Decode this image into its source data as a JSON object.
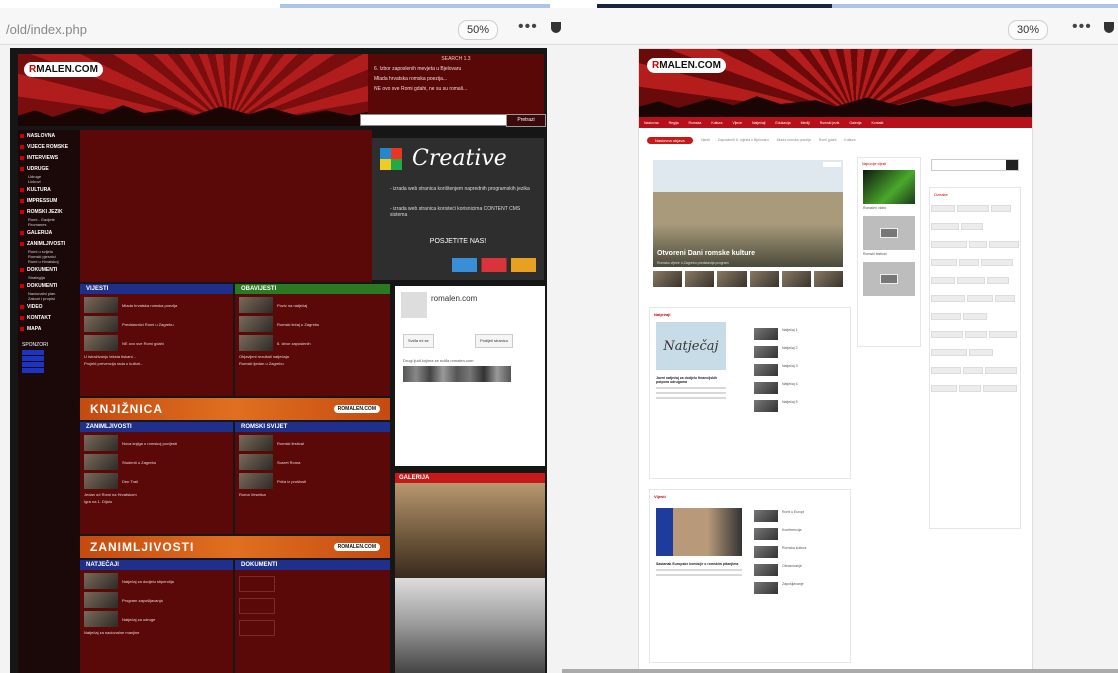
{
  "left": {
    "url": "/old/index.php",
    "zoom": "50%",
    "menu_dots": "•••",
    "site": {
      "logo_prefix": "R",
      "logo_rest": "MALEN.COM",
      "news_heading": "SEARCH 1.3",
      "news": [
        "6. Izbor zaposlenih mevjeta u Bjelovaru",
        "Mlada hrvatska romska poezija...",
        "NE ovo sve Romi gdahi, ne su su romali..."
      ],
      "search_button": "Pretrazi",
      "menu": [
        {
          "label": "NASLOVNA"
        },
        {
          "label": "VIJECE ROMSKE"
        },
        {
          "label": "INTERVIEWS"
        },
        {
          "label": "UDRUGE",
          "sub": [
            "Udruge",
            "Linkovi"
          ]
        },
        {
          "label": "KULTURA"
        },
        {
          "label": "IMPRESSUM"
        },
        {
          "label": "ROMSKI JEZIK",
          "sub": [
            "Romi - Gadjete",
            "Rromanes"
          ]
        },
        {
          "label": "GALERIJA"
        },
        {
          "label": "ZANIMLJIVOSTI",
          "sub": [
            "Romi u svijetu",
            "Romski pjesnici",
            "Romi u Hrvatskoj"
          ]
        },
        {
          "label": "DOKUMENTI",
          "sub": [
            "Strategija"
          ]
        },
        {
          "label": "DOKUMENTI",
          "sub": [
            "Nacionalni plan",
            "Zakoni i propisi"
          ]
        },
        {
          "label": "VIDEO"
        },
        {
          "label": "KONTAKT"
        },
        {
          "label": "MAPA"
        }
      ],
      "sponsors_label": "SPONZORI",
      "creative": {
        "title": "Creative",
        "bullets": [
          "- izrada web stranica korištenjem naprednih programskih jezika",
          "- izrada web stranica koristeći korisnicima CONTENT CMS sistema"
        ],
        "visit": "POSJETITE NAS!"
      },
      "sections": [
        {
          "title": "VIJESTI",
          "rows": [
            "Mlada hrvatska romska poezija",
            "Predstavnici Romi u Zagrebu",
            "NE ovo sve Romi gdahi"
          ],
          "footer": [
            "U Istraživanju teksta tiskani...",
            "Projekt prevencija rada u kulturi..."
          ]
        },
        {
          "title": "OBAVIJESTI",
          "rows": [
            "Poziv na natječaj",
            "Romski tečaj u Zagrebu",
            "6. Izbor zaposlenih"
          ],
          "footer": [
            "Objavljeni rezultati natječaja",
            "Romski tjedan u Zagrebu"
          ]
        },
        {
          "title": "ZANIMLJIVOSTI",
          "rows": [
            "Nova knjiga o romskoj povijesti",
            "Studenti u Zagrebu",
            "Den Trail"
          ],
          "footer": [
            "Jedan od Romi na Hrvatskom",
            "Igra na 1. Dijalu"
          ]
        },
        {
          "title": "ROMSKI SVIJET",
          "rows": [
            "Romski festival",
            "Susret Roma",
            "Priča iz prošlosti"
          ],
          "footer": [
            "Roma Veselica"
          ]
        },
        {
          "title": "NATJEČAJI",
          "rows": [
            "Natječaj za dodjelu stipendija",
            "Program zapošljavanja",
            "Natječaj za udruge"
          ],
          "footer": [
            "Natječaj za nacionalne manjine"
          ]
        },
        {
          "title": "DOKUMENTI",
          "rows": []
        }
      ],
      "bands": [
        "KNJIŽNICA",
        "ZANIMLJIVOSTI"
      ],
      "band_logo": "ROMALEN.COM",
      "fb": {
        "name": "romalen.com",
        "likes": "Sviđa mi se",
        "share": "Podijeli stranicu",
        "people": "Drugi ljudi kojima se sviđa romalen.com"
      },
      "gallery_title": "GALERIJA"
    }
  },
  "right": {
    "zoom": "30%",
    "menu_dots": "•••",
    "site": {
      "logo_prefix": "R",
      "logo_rest": "MALEN.COM",
      "nav": [
        "Naslovna",
        "Regija",
        "Romska",
        "Kultura",
        "Vijeće",
        "Natječaji",
        "Edukacija",
        "Mediji",
        "Romski jezik",
        "Galerija",
        "Kontakt"
      ],
      "tags_label": "Naslovna objava",
      "tags": [
        "Vijesti",
        "Zaposlenih 6. mjesta u Bjelovaru",
        "Mlada romska poezija",
        "Romi gdahi",
        "Kultura"
      ],
      "hero": {
        "caption": "Otvoreni Dani romske kulture",
        "sub": "Romsko vijeće u Zagrebu predstavlja program"
      },
      "sidebar_title": "Najnovije vijesti",
      "sidebar_items": [
        "Romalen video",
        "Romski festival"
      ],
      "search_placeholder": "",
      "tags_title": "Oznake",
      "natjecaj": {
        "section": "Natječaji",
        "image_text": "Natječaj",
        "caption": "Javni natječaj za dodjelu financijskih potpora udrugama",
        "list": [
          "Natječaj 1",
          "Natječaj 2",
          "Natječaj 3",
          "Natječaj 4",
          "Natječaj 5"
        ]
      },
      "second_section": "Vijesti",
      "second": {
        "caption": "Sastanak Europske komisije o romskim pitanjima",
        "list": [
          "Romi u Europi",
          "Konferencija",
          "Romska kultura",
          "Obrazovanje",
          "Zapošljavanje"
        ]
      }
    }
  }
}
